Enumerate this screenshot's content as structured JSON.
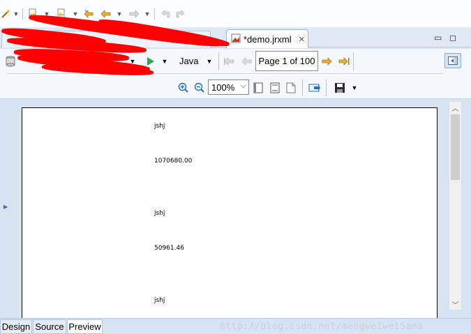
{
  "top_toolbar": {
    "icons": [
      "wand-icon",
      "dropdown",
      "next-annotation-icon",
      "dropdown",
      "prev-annotation-icon",
      "dropdown",
      "last-edit-icon",
      "back-icon",
      "dropdown",
      "forward-icon",
      "dropdown",
      "undo-nav-icon",
      "redo-nav-icon"
    ]
  },
  "editor_tabs": {
    "active_tab": "*demo.jrxml",
    "close_glyph": "✕",
    "minimize_glyph": "▭",
    "maximize_glyph": "◻"
  },
  "preview_toolbar": {
    "language": "Java",
    "language_dropdown": "▼",
    "page_indicator": "Page 1 of 100",
    "zoom": "100%",
    "zoom_dropdown": "⌵"
  },
  "report_rows": [
    {
      "label": "jshj",
      "value": "1070680.00"
    },
    {
      "label": "jshj",
      "value": "50961.46"
    },
    {
      "label": "jshj"
    }
  ],
  "bottom_tabs": [
    "Design",
    "Source",
    "Preview"
  ],
  "active_bottom_tab": "Preview",
  "watermark": "http://blog.csdn.net/mengweiweiSama",
  "colors": {
    "editor_background": "#d6e3f1",
    "toolbar_background": "#f4f7fb",
    "redaction": "#ff0000",
    "run_icon": "#2ea84a",
    "nav_arrow_enabled": "#e2b23a"
  }
}
